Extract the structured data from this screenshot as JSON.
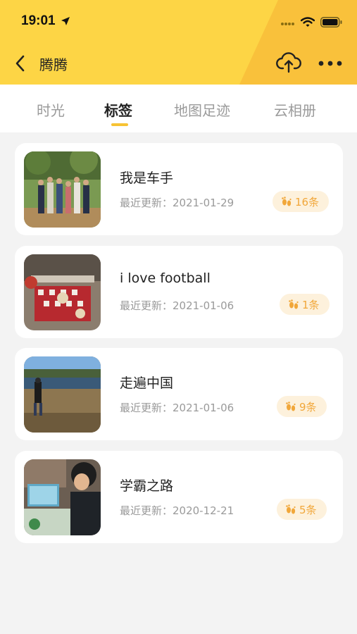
{
  "status_bar": {
    "time": "19:01"
  },
  "nav": {
    "title": "腾腾"
  },
  "tabs": [
    {
      "label": "时光"
    },
    {
      "label": "标签"
    },
    {
      "label": "地图足迹"
    },
    {
      "label": "云相册"
    }
  ],
  "active_tab": "标签",
  "cards": [
    {
      "title": "我是车手",
      "date": "最近更新：2021-01-29",
      "count": "16条"
    },
    {
      "title": "i love football",
      "date": "最近更新：2021-01-06",
      "count": "1条"
    },
    {
      "title": "走遍中国",
      "date": "最近更新：2021-01-06",
      "count": "9条"
    },
    {
      "title": "学霸之路",
      "date": "最近更新：2020-12-21",
      "count": "5条"
    }
  ],
  "colors": {
    "header_yellow": "#fdd545",
    "header_orange": "#f9c13b",
    "accent": "#f7c334",
    "badge_bg": "#fdf1dc",
    "badge_text": "#f1a73a"
  },
  "icons": [
    "location-arrow-icon",
    "signal-icon",
    "wifi-icon",
    "battery-icon",
    "back-arrow-icon",
    "cloud-upload-icon",
    "more-dots-icon",
    "footprint-icon"
  ]
}
